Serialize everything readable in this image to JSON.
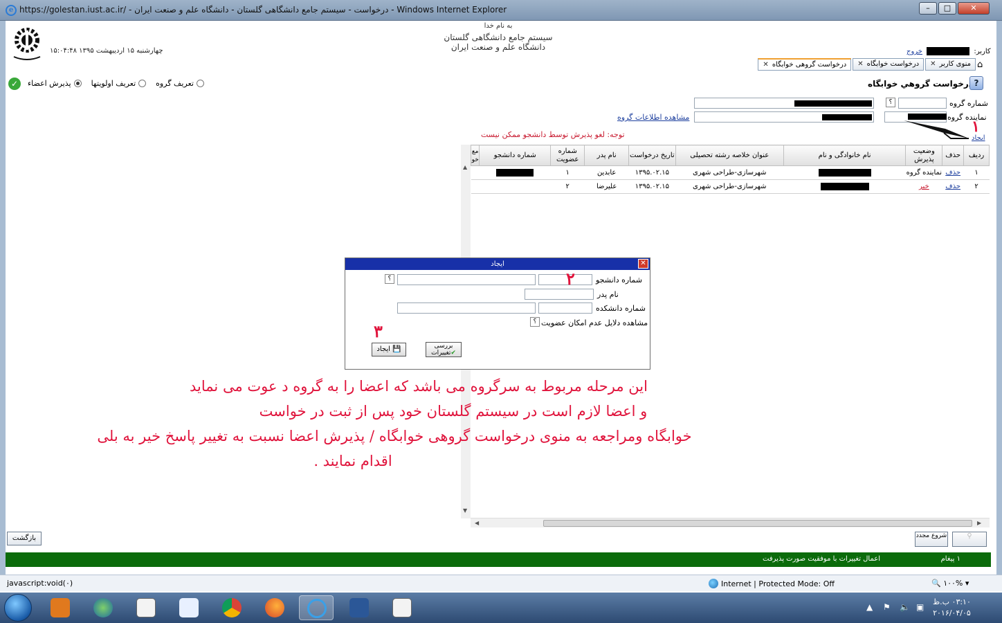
{
  "window": {
    "title": "https://golestan.iust.ac.ir/ - درخواست - سیستم جامع دانشگاهی گلستان - دانشگاه علم و صنعت ایران - Windows Internet Explorer"
  },
  "header": {
    "basmala": "به نام خدا",
    "system_name": "سیستم جامع دانشگاهی گلستان",
    "university": "دانشگاه علم و صنعت ایران",
    "datetime": "۱۵:۰۴:۴۸ چهارشنبه ۱۵ اردیبهشت ۱۳۹۵",
    "user_label": "کاربر:",
    "logout": "خروج"
  },
  "tabs": [
    {
      "label": "منوی کاربر"
    },
    {
      "label": "درخواست خوابگاه"
    },
    {
      "label": "درخواست گروهی خوابگاه"
    }
  ],
  "radios": {
    "items": [
      {
        "label": "تعریف گروه",
        "selected": false
      },
      {
        "label": "تعریف اولویتها",
        "selected": false
      },
      {
        "label": "پذیرش اعضاء",
        "selected": true
      }
    ]
  },
  "form": {
    "page_title": "درخواست گروهي خوابگاه",
    "group_number_label": "شماره گروه",
    "group_number_help": "؟",
    "group_rep_label": "نماینده گروه",
    "view_group_info": "مشاهده اطلاعات گروه",
    "create_link": "ایجاد",
    "note": "توجه: لغو پذیرش توسط دانشجو ممکن نیست"
  },
  "table": {
    "headers": [
      "ردیف",
      "حذف",
      "وضعیت پذیرش",
      "نام خانوادگی و نام",
      "عنوان خلاصه رشته تحصیلی",
      "تاریخ درخواست",
      "نام پدر",
      "شماره عضویت",
      "شماره دانشجو",
      "مع خو"
    ],
    "rows": [
      {
        "row": "۱",
        "delete": "حذف",
        "status": "نماینده گروه",
        "field": "شهرسازی-طراحی شهری",
        "date": "۱۳۹۵.۰۲.۱۵",
        "father": "عابدین",
        "member": "۱"
      },
      {
        "row": "۲",
        "delete": "حذف",
        "status": "خیر",
        "field": "شهرسازی-طراحی شهری",
        "date": "۱۳۹۵.۰۲.۱۵",
        "father": "علیرضا",
        "member": "۲"
      }
    ]
  },
  "dialog": {
    "title": "ایجاد",
    "student_no_label": "شماره دانشجو",
    "help": "؟",
    "father_label": "نام پدر",
    "faculty_no_label": "شماره دانشکده",
    "reasons_label": "مشاهده دلایل عدم امکان عضویت",
    "create_button": "ایجاد",
    "review_button": "بررسی تغییرات"
  },
  "annotations": {
    "n1": "۱",
    "n2": "۲",
    "n3": "۳",
    "instruction_l1": "این مرحله  مربوط به سرگروه می باشد که  اعضا را به گروه د عوت  می نماید",
    "instruction_l2": "و اعضا لازم است در سیستم گلستان خود پس از ثبت در خواست",
    "instruction_l3": "خوابگاه ومراجعه به منوی درخواست گروهی خوابگاه / پذیرش اعضا نسبت به تغییر پاسخ خیر به  بلی",
    "instruction_l4": "اقدام نمایند ."
  },
  "bottom": {
    "back": "بازگشت",
    "start_again": "شروع مجدد",
    "messages_count": "۱ پیغام",
    "message": "اعمال تغییرات با موفقیت صورت پذیرفت"
  },
  "statusbar": {
    "left": "javascript:void(۰)",
    "zone": "Internet | Protected Mode: Off",
    "zoom": "۱۰۰%"
  },
  "taskbar": {
    "time": "۰۳:۱۰ ب.ظ",
    "date": "۲۰۱۶/۰۴/۰۵"
  },
  "colors": {
    "link": "#1d3f9e",
    "red": "#c8182e",
    "dialog_title": "#1730a8",
    "message_bar": "#0b6b0b"
  }
}
